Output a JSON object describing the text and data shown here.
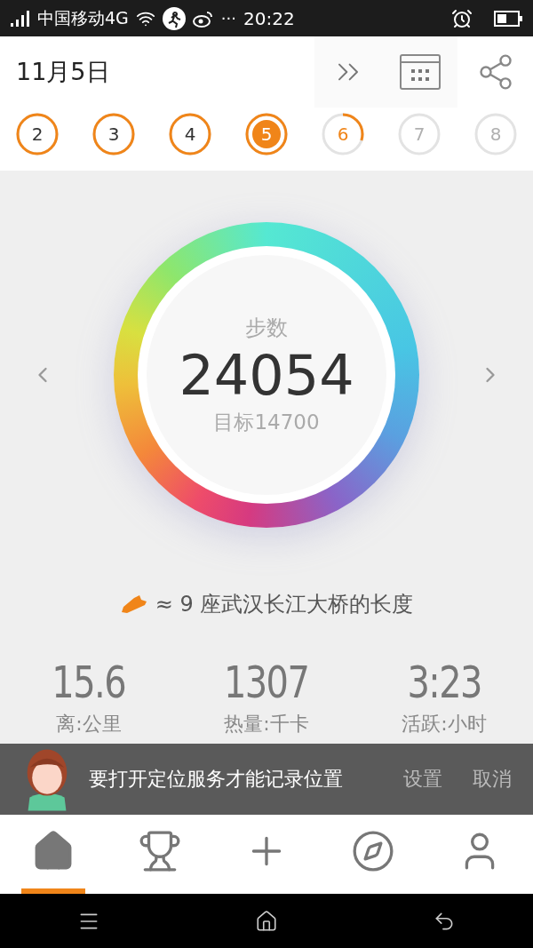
{
  "status_bar": {
    "carrier": "中国移动4G",
    "more": "···",
    "time": "20:22"
  },
  "header": {
    "date": "11月5日"
  },
  "days": [
    {
      "label": "2",
      "complete": true,
      "selected": false,
      "disabled": false
    },
    {
      "label": "3",
      "complete": true,
      "selected": false,
      "disabled": false
    },
    {
      "label": "4",
      "complete": true,
      "selected": false,
      "disabled": false
    },
    {
      "label": "5",
      "complete": true,
      "selected": true,
      "disabled": false
    },
    {
      "label": "6",
      "complete": false,
      "selected": false,
      "disabled": false
    },
    {
      "label": "7",
      "complete": false,
      "selected": false,
      "disabled": true
    },
    {
      "label": "8",
      "complete": false,
      "selected": false,
      "disabled": true
    }
  ],
  "steps": {
    "title": "步数",
    "value": "24054",
    "goal": "目标14700"
  },
  "comparison": "≈ 9 座武汉长江大桥的长度",
  "stats": [
    {
      "value": "15.6",
      "label": "离:公里"
    },
    {
      "value": "1307",
      "label": "热量:千卡"
    },
    {
      "value": "3:23",
      "label": "活跃:小时"
    }
  ],
  "toast": {
    "message": "要打开定位服务才能记录位置",
    "actions": [
      "设置",
      "取消"
    ]
  },
  "nav": [
    {
      "selected": true
    },
    {
      "selected": false
    },
    {
      "selected": false
    },
    {
      "selected": false
    },
    {
      "selected": false
    }
  ]
}
